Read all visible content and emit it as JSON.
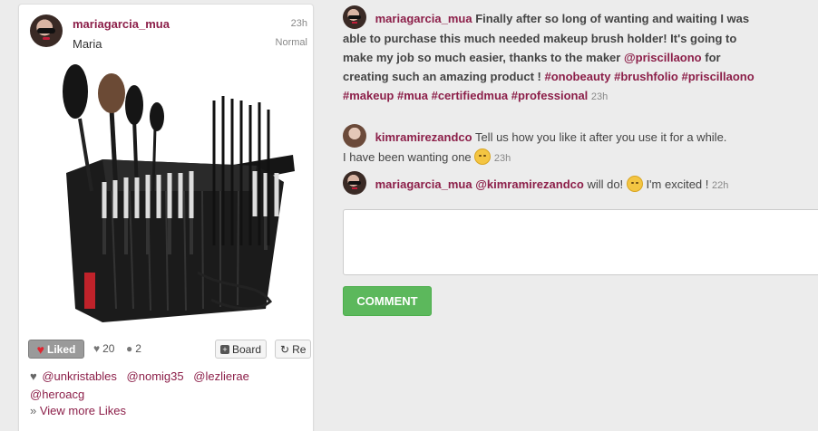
{
  "card": {
    "username": "mariagarcia_mua",
    "fullname": "Maria",
    "time": "23h",
    "filter": "Normal",
    "liked_label": "Liked",
    "likes_count": "20",
    "comments_count": "2",
    "board_label": "Board",
    "repost_label": "Re",
    "likers": [
      "@unkristables",
      "@nomig35",
      "@lezlierae",
      "@heroacg"
    ],
    "view_more": "View more Likes"
  },
  "post": {
    "username": "mariagarcia_mua",
    "text1": "Finally after so long of wanting and waiting I was able to purchase this much needed makeup brush holder! It's going to make my job so much easier, thanks to the maker",
    "mention": "@priscillaono",
    "text2": "for creating such an amazing product !",
    "hashtags": [
      "#onobeauty",
      "#brushfolio",
      "#priscillaono",
      "#makeup",
      "#mua",
      "#certifiedmua",
      "#professional"
    ],
    "time": "23h"
  },
  "comments": [
    {
      "username": "kimramirezandco",
      "text": "Tell us how you like it after you use it for a while.",
      "text2": "I have been wanting one",
      "time": "23h"
    },
    {
      "username": "mariagarcia_mua",
      "mention": "@kimramirezandco",
      "text": "will do!",
      "text2": "I'm excited !",
      "time": "22h"
    }
  ],
  "comment_button": "COMMENT"
}
